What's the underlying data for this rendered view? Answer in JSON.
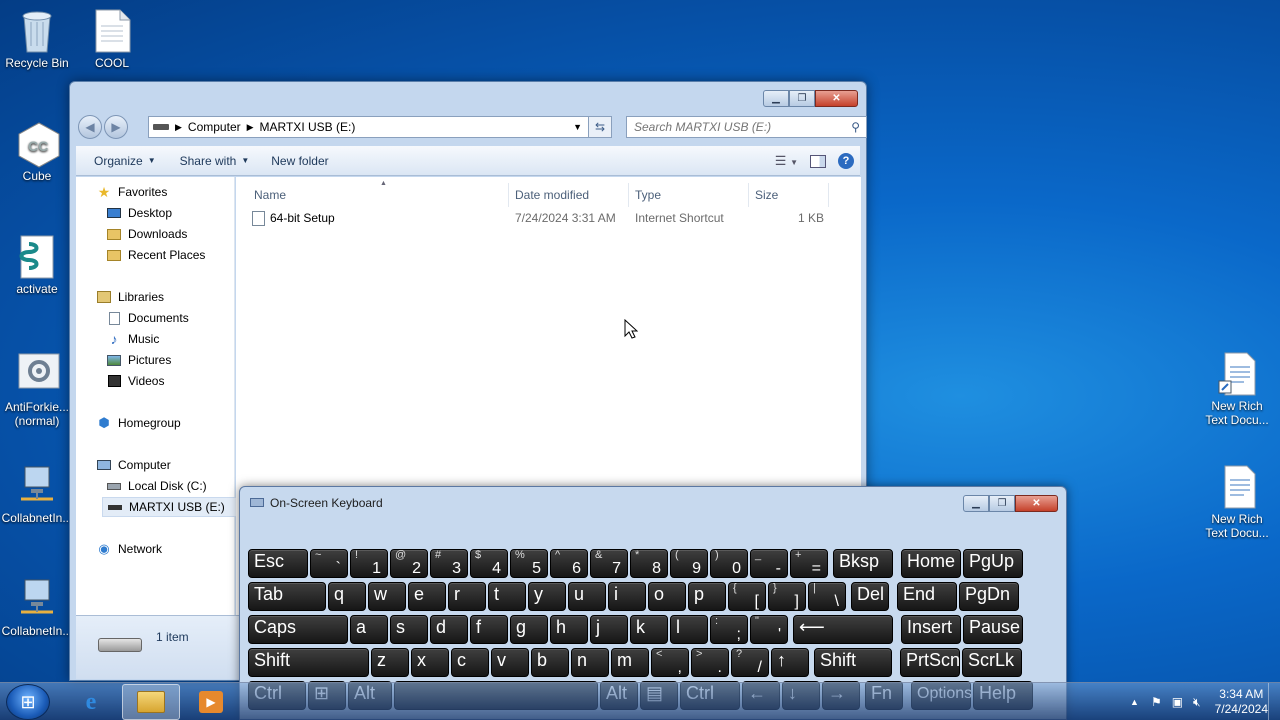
{
  "desktop": {
    "icons": [
      {
        "label": "Recycle Bin"
      },
      {
        "label": "COOL"
      },
      {
        "label": "Cube"
      },
      {
        "label": "activate"
      },
      {
        "label": "AntiForkie...\n(normal)"
      },
      {
        "label": "CollabnetIn..."
      },
      {
        "label": "CollabnetIn..."
      },
      {
        "label": "New Rich\nText Docu..."
      },
      {
        "label": "New Rich\nText Docu..."
      }
    ]
  },
  "explorer": {
    "address": {
      "seg1": "Computer",
      "seg2": "MARTXI USB (E:)"
    },
    "search_placeholder": "Search MARTXI USB (E:)",
    "toolbar": {
      "organize": "Organize",
      "share_with": "Share with",
      "new_folder": "New folder"
    },
    "nav": {
      "favorites": "Favorites",
      "desktop": "Desktop",
      "downloads": "Downloads",
      "recent_places": "Recent Places",
      "libraries": "Libraries",
      "documents": "Documents",
      "music": "Music",
      "pictures": "Pictures",
      "videos": "Videos",
      "homegroup": "Homegroup",
      "computer": "Computer",
      "local_disk": "Local Disk (C:)",
      "usb": "MARTXI USB (E:)",
      "network": "Network"
    },
    "columns": {
      "name": "Name",
      "date_modified": "Date modified",
      "type": "Type",
      "size": "Size"
    },
    "files": [
      {
        "name": "64-bit Setup",
        "date_modified": "7/24/2024 3:31 AM",
        "type": "Internet Shortcut",
        "size": "1 KB"
      }
    ],
    "details": {
      "item_count": "1 item"
    }
  },
  "osk": {
    "title": "On-Screen Keyboard",
    "rows": [
      [
        {
          "m": "Esc"
        },
        {
          "s": "~",
          "b": "`"
        },
        {
          "s": "!",
          "b": "1"
        },
        {
          "s": "@",
          "b": "2"
        },
        {
          "s": "#",
          "b": "3"
        },
        {
          "s": "$",
          "b": "4"
        },
        {
          "s": "%",
          "b": "5"
        },
        {
          "s": "^",
          "b": "6"
        },
        {
          "s": "&",
          "b": "7"
        },
        {
          "s": "*",
          "b": "8"
        },
        {
          "s": "(",
          "b": "9"
        },
        {
          "s": ")",
          "b": "0"
        },
        {
          "s": "_",
          "b": "-"
        },
        {
          "s": "+",
          "b": "="
        },
        {
          "m": "Bksp"
        },
        {
          "m": "Home"
        },
        {
          "m": "PgUp"
        }
      ],
      [
        {
          "m": "Tab"
        },
        {
          "m": "q"
        },
        {
          "m": "w"
        },
        {
          "m": "e"
        },
        {
          "m": "r"
        },
        {
          "m": "t"
        },
        {
          "m": "y"
        },
        {
          "m": "u"
        },
        {
          "m": "i"
        },
        {
          "m": "o"
        },
        {
          "m": "p"
        },
        {
          "s": "{",
          "b": "["
        },
        {
          "s": "}",
          "b": "]"
        },
        {
          "s": "|",
          "b": "\\"
        },
        {
          "m": "Del"
        },
        {
          "m": "End"
        },
        {
          "m": "PgDn"
        }
      ],
      [
        {
          "m": "Caps"
        },
        {
          "m": "a"
        },
        {
          "m": "s"
        },
        {
          "m": "d"
        },
        {
          "m": "f"
        },
        {
          "m": "g"
        },
        {
          "m": "h"
        },
        {
          "m": "j"
        },
        {
          "m": "k"
        },
        {
          "m": "l"
        },
        {
          "s": ":",
          "b": ";"
        },
        {
          "s": "\"",
          "b": "'"
        },
        {
          "m": "⟵"
        },
        {
          "m": "Insert"
        },
        {
          "m": "Pause"
        }
      ],
      [
        {
          "m": "Shift"
        },
        {
          "m": "z"
        },
        {
          "m": "x"
        },
        {
          "m": "c"
        },
        {
          "m": "v"
        },
        {
          "m": "b"
        },
        {
          "m": "n"
        },
        {
          "m": "m"
        },
        {
          "s": "<",
          "b": ","
        },
        {
          "s": ">",
          "b": "."
        },
        {
          "s": "?",
          "b": "/"
        },
        {
          "m": "↑"
        },
        {
          "m": "Shift"
        },
        {
          "m": "PrtScn"
        },
        {
          "m": "ScrLk"
        }
      ],
      [
        {
          "m": "Ctrl"
        },
        {
          "m": "⊞"
        },
        {
          "m": "Alt"
        },
        {
          "m": ""
        },
        {
          "m": "Alt"
        },
        {
          "m": "▤"
        },
        {
          "m": "Ctrl"
        },
        {
          "m": "←"
        },
        {
          "m": "↓"
        },
        {
          "m": "→"
        },
        {
          "m": "Fn"
        },
        {
          "m": "Options"
        },
        {
          "m": "Help"
        }
      ]
    ]
  },
  "taskbar": {
    "clock_time": "3:34 AM",
    "clock_date": "7/24/2024"
  },
  "colors": {
    "accent": "#0a68c9",
    "osk_key": "#1e1e1e"
  }
}
